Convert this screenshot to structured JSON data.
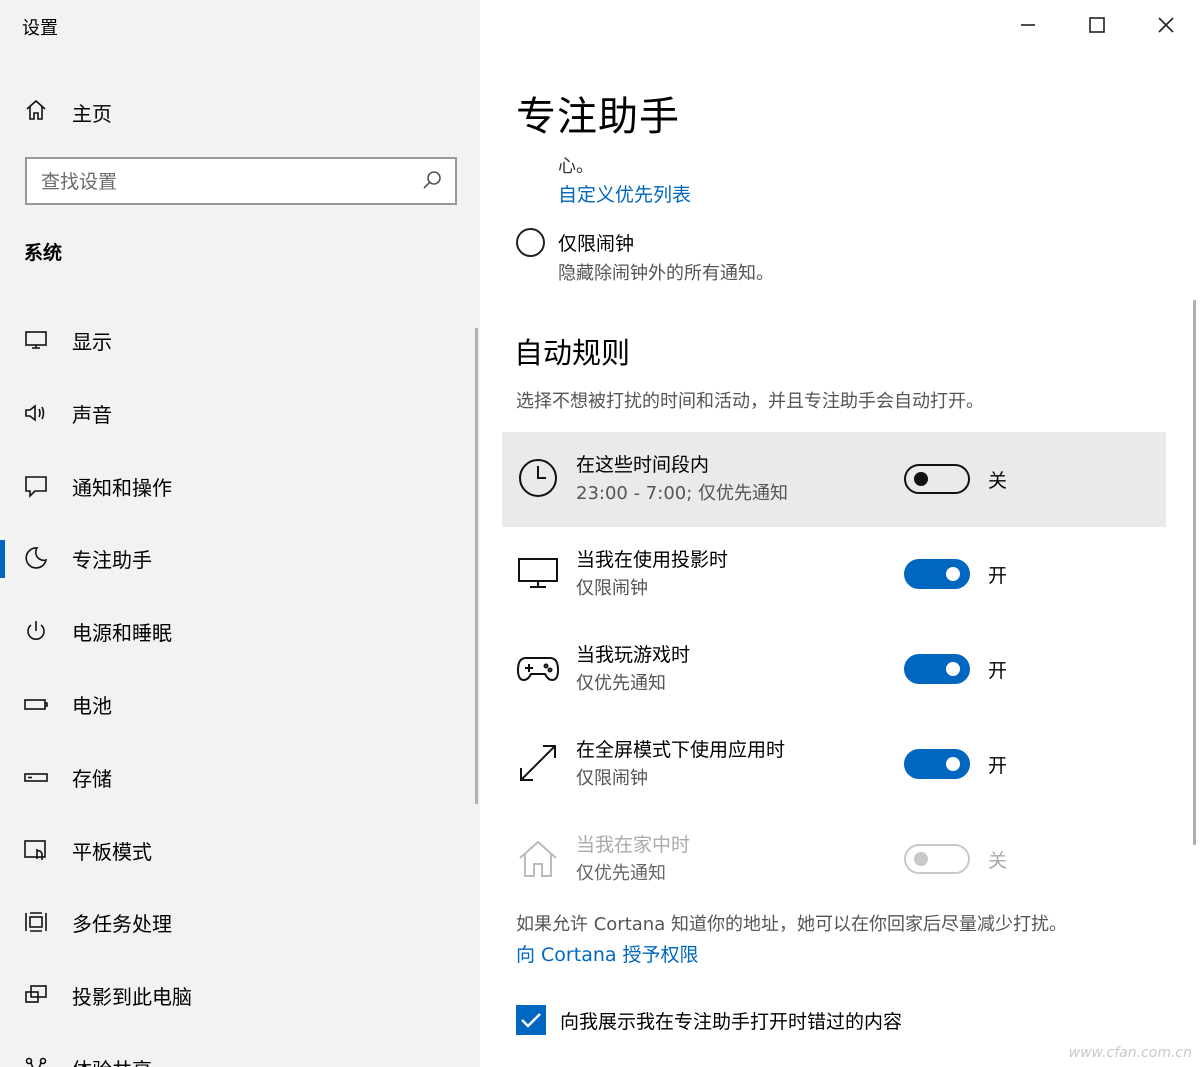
{
  "window": {
    "title": "设置"
  },
  "sidebar": {
    "home_label": "主页",
    "search_placeholder": "查找设置",
    "section_heading": "系统",
    "items": [
      {
        "label": "显示",
        "icon": "display-icon"
      },
      {
        "label": "声音",
        "icon": "speaker-icon"
      },
      {
        "label": "通知和操作",
        "icon": "notification-icon"
      },
      {
        "label": "专注助手",
        "icon": "moon-icon",
        "active": true
      },
      {
        "label": "电源和睡眠",
        "icon": "power-icon"
      },
      {
        "label": "电池",
        "icon": "battery-icon"
      },
      {
        "label": "存储",
        "icon": "storage-icon"
      },
      {
        "label": "平板模式",
        "icon": "tablet-mode-icon"
      },
      {
        "label": "多任务处理",
        "icon": "multitasking-icon"
      },
      {
        "label": "投影到此电脑",
        "icon": "project-icon"
      },
      {
        "label": "体验共享",
        "icon": "share-icon"
      }
    ]
  },
  "main": {
    "title": "专注助手",
    "partial_text": "心。",
    "customize_link": "自定义优先列表",
    "alarms_only": {
      "label": "仅限闹钟",
      "description": "隐藏除闹钟外的所有通知。"
    },
    "auto_rules": {
      "title": "自动规则",
      "description": "选择不想被打扰的时间和活动，并且专注助手会自动打开。",
      "rules": [
        {
          "title": "在这些时间段内",
          "subtitle": "23:00 - 7:00; 仅优先通知",
          "state": "关",
          "on": false,
          "icon": "clock-icon"
        },
        {
          "title": "当我在使用投影时",
          "subtitle": "仅限闹钟",
          "state": "开",
          "on": true,
          "icon": "monitor-icon"
        },
        {
          "title": "当我玩游戏时",
          "subtitle": "仅优先通知",
          "state": "开",
          "on": true,
          "icon": "gamepad-icon"
        },
        {
          "title": "在全屏模式下使用应用时",
          "subtitle": "仅限闹钟",
          "state": "开",
          "on": true,
          "icon": "fullscreen-icon"
        },
        {
          "title": "当我在家中时",
          "subtitle": "仅优先通知",
          "state": "关",
          "on": false,
          "disabled": true,
          "icon": "home-icon"
        }
      ]
    },
    "cortana_text": "如果允许 Cortana 知道你的地址，她可以在你回家后尽量减少打扰。",
    "cortana_link": "向 Cortana 授予权限",
    "show_missed_label": "向我展示我在专注助手打开时错过的内容",
    "show_missed_checked": true
  },
  "watermark": "www.cfan.com.cn",
  "colors": {
    "accent": "#0067c0",
    "sidebar_bg": "#f2f2f2",
    "highlight_bg": "#eaeaea"
  }
}
